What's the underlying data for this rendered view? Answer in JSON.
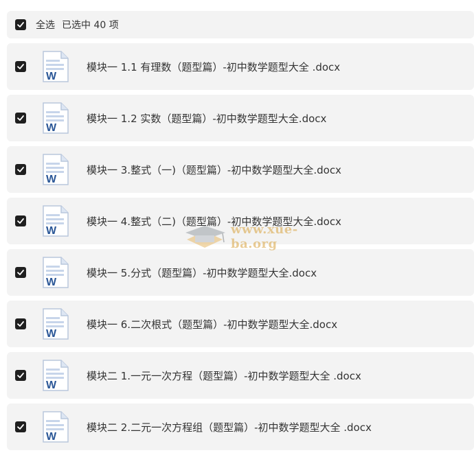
{
  "header": {
    "select_all_label": "全选",
    "selected_text": "已选中  40  项"
  },
  "files": [
    {
      "name": "模块一 1.1 有理数（题型篇）-初中数学题型大全 .docx",
      "icon": "word-doc-icon",
      "checked": true
    },
    {
      "name": "模块一 1.2 实数（题型篇）-初中数学题型大全.docx",
      "icon": "word-doc-icon",
      "checked": true
    },
    {
      "name": "模块一 3.整式（一)（题型篇）-初中数学题型大全.docx",
      "icon": "word-doc-icon",
      "checked": true
    },
    {
      "name": "模块一 4.整式（二)（题型篇）-初中数学题型大全.docx",
      "icon": "word-doc-icon",
      "checked": true
    },
    {
      "name": "模块一 5.分式（题型篇）-初中数学题型大全.docx",
      "icon": "word-doc-icon",
      "checked": true
    },
    {
      "name": "模块一 6.二次根式（题型篇）-初中数学题型大全.docx",
      "icon": "word-doc-icon",
      "checked": true
    },
    {
      "name": "模块二 1.一元一次方程（题型篇）-初中数学题型大全 .docx",
      "icon": "word-doc-icon",
      "checked": true
    },
    {
      "name": "模块二 2.二元一次方程组（题型篇）-初中数学题型大全 .docx",
      "icon": "word-doc-icon",
      "checked": true
    }
  ],
  "watermark": {
    "text": "www.xue-ba.org"
  },
  "colors": {
    "row_bg": "#f3f3f3",
    "checkbox": "#1f1f1f",
    "word_blue": "#2b5797",
    "text": "#333333"
  }
}
